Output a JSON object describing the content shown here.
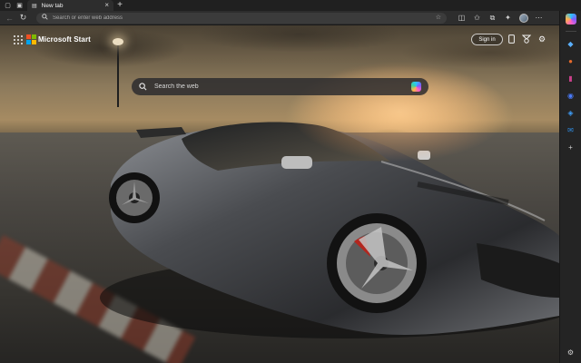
{
  "browser": {
    "tab": {
      "label": "New tab"
    },
    "new_tab_symbol": "+",
    "address": {
      "placeholder": "Search or enter web address",
      "value": ""
    }
  },
  "page": {
    "brand": {
      "name": "Microsoft Start",
      "logo_colors": [
        "#f25022",
        "#7fba00",
        "#00a4ef",
        "#ffb900"
      ]
    },
    "sign_in_label": "Sign in",
    "search": {
      "placeholder": "Search the web"
    }
  },
  "icons": {
    "tabstrip": [
      "tab-actions-icon",
      "workspaces-icon"
    ],
    "toolbar": [
      "back-icon",
      "refresh-icon",
      "search-icon",
      "favorite-star-icon",
      "split-screen-icon",
      "favorites-icon",
      "collections-icon",
      "extensions-icon",
      "profile-avatar",
      "more-icon"
    ],
    "page_top": [
      "apps-grid-icon",
      "phone-icon",
      "rewards-icon",
      "settings-icon"
    ],
    "sidebar": [
      "copilot-icon",
      "search-icon",
      "shopping-icon",
      "tools-icon",
      "games-icon",
      "microsoft-365-icon",
      "outlook-icon",
      "add-icon",
      "settings-icon"
    ]
  },
  "colors": {
    "copilot_gradient": [
      "#2ac3ff",
      "#7b5cff",
      "#ff5ec4",
      "#ffb347"
    ],
    "chrome_dark": "#2d2d2d"
  }
}
